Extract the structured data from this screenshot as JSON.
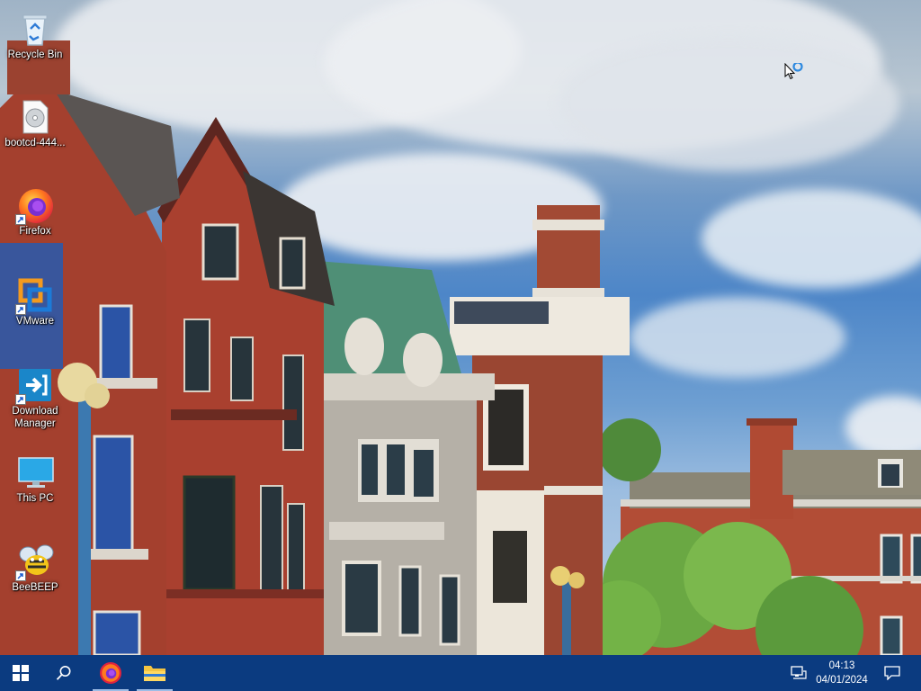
{
  "desktop": {
    "icons": [
      {
        "label": "Recycle Bin"
      },
      {
        "label": "bootcd-444..."
      },
      {
        "label": "Firefox"
      },
      {
        "label": "VMware"
      },
      {
        "label": "Download Manager"
      },
      {
        "label": "This PC"
      },
      {
        "label": "BeeBEEP"
      }
    ]
  },
  "taskbar": {
    "start_icon": "windows-start-icon",
    "search_icon": "search-icon",
    "pinned": [
      {
        "name": "Firefox",
        "icon": "firefox-icon",
        "open": true
      },
      {
        "name": "File Explorer",
        "icon": "folder-icon",
        "open": true
      }
    ],
    "tray": {
      "network_icon": "network-icon",
      "time": "04:13",
      "date": "04/01/2024",
      "notification_icon": "action-center-icon"
    }
  },
  "colors": {
    "taskbar": "#0b3b80",
    "sky": "#4d86c8",
    "brick": "#9a3c2c"
  }
}
